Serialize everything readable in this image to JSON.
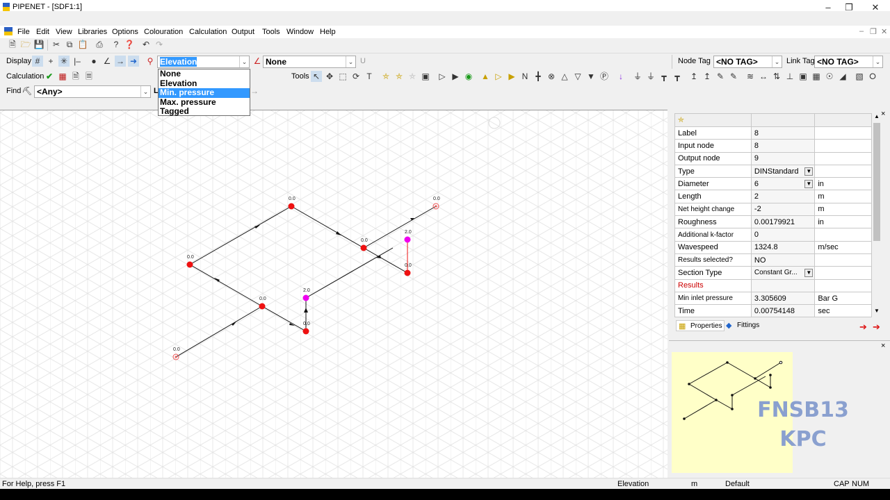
{
  "window": {
    "title": "PIPENET - [SDF1:1]"
  },
  "menu": [
    "File",
    "Edit",
    "View",
    "Libraries",
    "Options",
    "Colouration",
    "Calculation",
    "Output",
    "Tools",
    "Window",
    "Help"
  ],
  "toolbar": {
    "display_label": "Display",
    "node_colour_value": "Elevation",
    "link_colour_value": "None",
    "u_label": "U",
    "node_tag_label": "Node Tag",
    "node_tag_value": "<NO TAG>",
    "link_tag_label": "Link Tag",
    "link_tag_value": "<NO TAG>",
    "calculation_label": "Calculation",
    "tools_label": "Tools",
    "find_label": "Find",
    "find_value": "<Any>",
    "l_label": "L"
  },
  "dropdown_options": [
    {
      "label": "None",
      "selected": false
    },
    {
      "label": "Elevation",
      "selected": false
    },
    {
      "label": "Min. pressure",
      "selected": true
    },
    {
      "label": "Max. pressure",
      "selected": false
    },
    {
      "label": "Tagged",
      "selected": false
    }
  ],
  "network": {
    "node_labels": [
      "0.0",
      "0.0",
      "0.0",
      "0.0",
      "2.0",
      "0.0",
      "0.0",
      "0.0",
      "2.0",
      "0.0",
      "0.0"
    ]
  },
  "properties": {
    "rows": [
      {
        "name": "Label",
        "value": "8",
        "unit": ""
      },
      {
        "name": "Input node",
        "value": "8",
        "unit": ""
      },
      {
        "name": "Output node",
        "value": "9",
        "unit": ""
      },
      {
        "name": "Type",
        "value": "DINStandard",
        "unit": ""
      },
      {
        "name": "Diameter",
        "value": "6",
        "unit": "in"
      },
      {
        "name": "Length",
        "value": "2",
        "unit": "m"
      },
      {
        "name": "Net height change",
        "value": "-2",
        "unit": "m"
      },
      {
        "name": "Roughness",
        "value": "0.00179921",
        "unit": "in"
      },
      {
        "name": "Additional k-factor",
        "value": "0",
        "unit": ""
      },
      {
        "name": "Wavespeed",
        "value": "1324.8",
        "unit": "m/sec"
      },
      {
        "name": "Results selected?",
        "value": "NO",
        "unit": ""
      },
      {
        "name": "Section Type",
        "value": "Constant Gr...",
        "unit": ""
      },
      {
        "name": "Results",
        "value": "",
        "unit": ""
      },
      {
        "name": "Min inlet pressure",
        "value": "3.305609",
        "unit": "Bar G"
      },
      {
        "name": "Time",
        "value": "0.00754148",
        "unit": "sec"
      }
    ],
    "tab_properties": "Properties",
    "tab_fittings": "Fittings"
  },
  "watermark": {
    "line1": "FNSB13",
    "line2": "KPC"
  },
  "status": {
    "help": "For Help, press F1",
    "mode": "Elevation",
    "unit": "m",
    "scheme": "Default",
    "cap": "CAP",
    "num": "NUM"
  },
  "colors": {
    "node_red": "#ee1111",
    "node_magenta": "#ee00ee",
    "selection": "#3399ff",
    "results_red": "#cc0000"
  }
}
